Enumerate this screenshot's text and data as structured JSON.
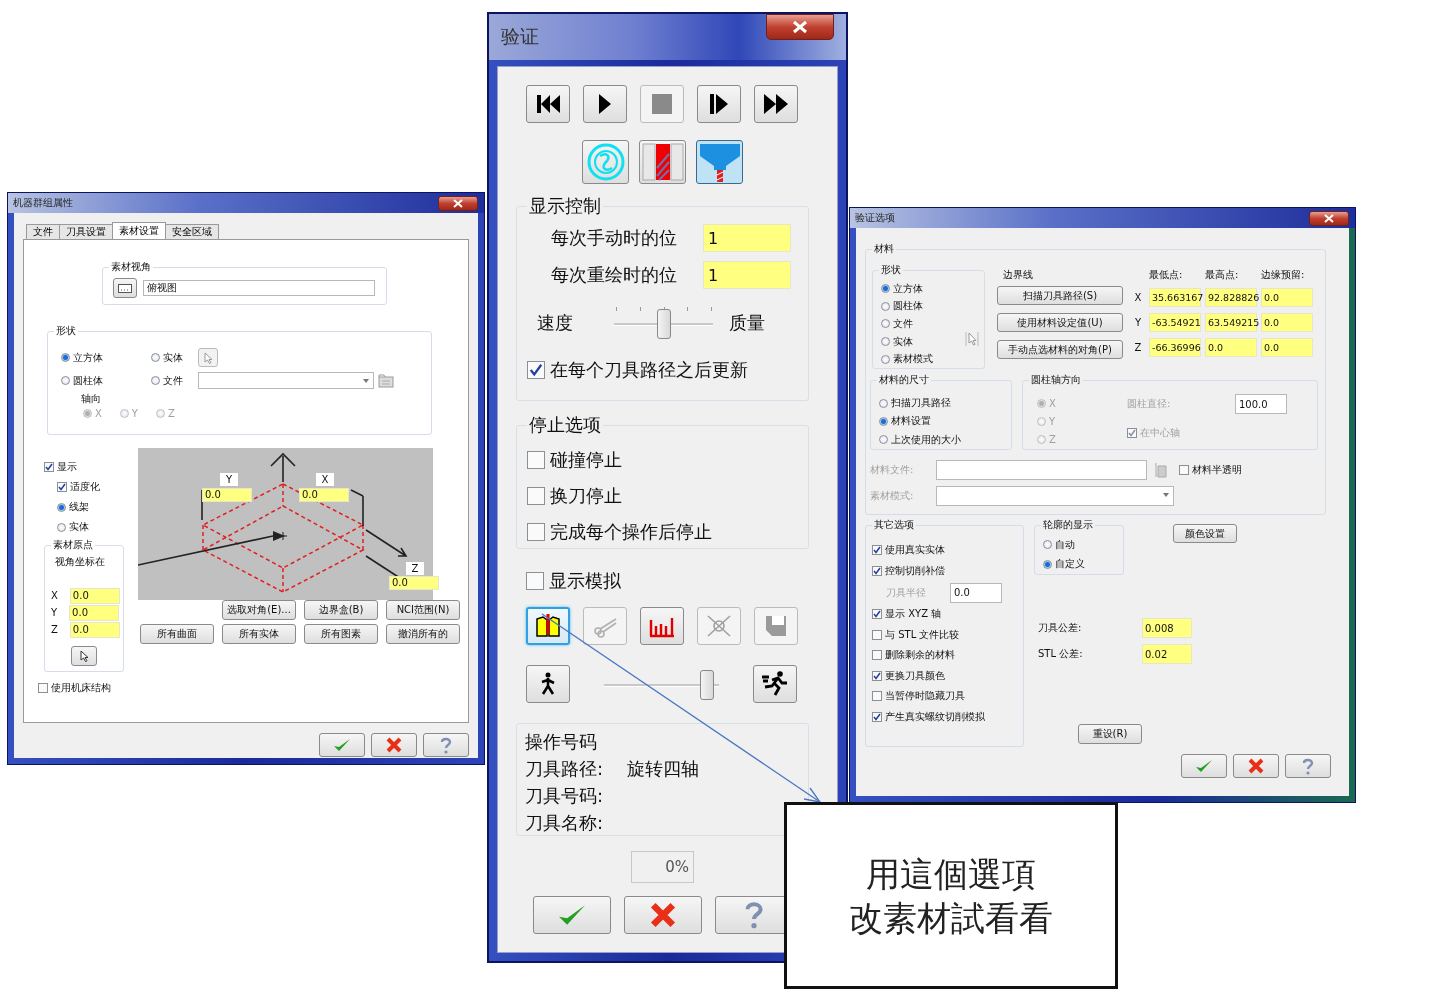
{
  "left_window": {
    "title": "机器群组属性",
    "tabs": [
      {
        "label": "文件",
        "selected": false
      },
      {
        "label": "刀具设置",
        "selected": false
      },
      {
        "label": "素材设置",
        "selected": true
      },
      {
        "label": "安全区域",
        "selected": false
      }
    ],
    "stock_view": {
      "title": "素材视角",
      "value": "俯视图"
    },
    "shape": {
      "title": "形状",
      "options": [
        {
          "label": "立方体",
          "selected": true
        },
        {
          "label": "实体",
          "selected": false
        },
        {
          "label": "圆柱体",
          "selected": false
        },
        {
          "label": "文件",
          "selected": false
        }
      ],
      "axis_title": "轴向",
      "axes_disabled": true,
      "axes": [
        {
          "label": "X",
          "selected": true
        },
        {
          "label": "Y",
          "selected": false
        },
        {
          "label": "Z",
          "selected": false
        }
      ]
    },
    "display": {
      "label": "显示",
      "checked": true
    },
    "display_options": [
      {
        "kind": "checkbox",
        "label": "适度化",
        "checked": true
      },
      {
        "kind": "radio",
        "label": "线架",
        "selected": true
      },
      {
        "kind": "radio",
        "label": "实体",
        "selected": false
      }
    ],
    "origin": {
      "title": "素材原点",
      "subtitle": "视角坐标在",
      "coords": [
        {
          "axis": "X",
          "value": "0.0"
        },
        {
          "axis": "Y",
          "value": "0.0"
        },
        {
          "axis": "Z",
          "value": "0.0"
        }
      ]
    },
    "preview_labels": [
      {
        "axis": "Y",
        "value": "0.0"
      },
      {
        "axis": "X",
        "value": "0.0"
      },
      {
        "axis": "Z",
        "value": "0.0"
      }
    ],
    "button_rows": [
      [
        "选取对角(E)...",
        "边界盒(B)",
        "NCI范围(N)"
      ],
      [
        "所有曲面",
        "所有实体",
        "所有图素",
        "撤消所有的"
      ]
    ],
    "machine_structure": {
      "label": "使用机床结构",
      "checked": false
    }
  },
  "middle_window": {
    "title": "验证",
    "player_buttons": [
      {
        "kind": "rewind",
        "disabled": false
      },
      {
        "kind": "play",
        "disabled": false
      },
      {
        "kind": "stop",
        "disabled": true
      },
      {
        "kind": "step",
        "disabled": false
      },
      {
        "kind": "forward",
        "disabled": false
      }
    ],
    "mode_buttons": [
      {
        "kind": "swirl"
      },
      {
        "kind": "stock_bar"
      },
      {
        "kind": "tool"
      }
    ],
    "display_control": {
      "title": "显示控制",
      "fields": [
        {
          "label": "每次手动时的位",
          "value": "1"
        },
        {
          "label": "每次重绘时的位",
          "value": "1"
        }
      ],
      "slider": {
        "left": "速度",
        "right": "质量",
        "level": 0.5
      },
      "update": {
        "label": "在每个刀具路径之后更新",
        "checked": true
      }
    },
    "stop_options": {
      "title": "停止选项",
      "items": [
        {
          "label": "碰撞停止",
          "checked": false
        },
        {
          "label": "换刀停止",
          "checked": false
        },
        {
          "label": "完成每个操作后停止",
          "checked": false
        }
      ]
    },
    "simulate": {
      "label": "显示模拟",
      "checked": false
    },
    "tool_buttons": [
      {
        "kind": "stock",
        "selected": true,
        "disabled": false
      },
      {
        "kind": "scissors",
        "selected": false,
        "disabled": true
      },
      {
        "kind": "bars",
        "selected": false,
        "disabled": false
      },
      {
        "kind": "cross",
        "selected": false,
        "disabled": true
      },
      {
        "kind": "disk",
        "selected": false,
        "disabled": true
      }
    ],
    "speed_slider": {
      "level": 0.95
    },
    "info": {
      "title": "操作号码",
      "rows": [
        {
          "label": "刀具路径:",
          "value": "旋转四轴"
        },
        {
          "label": "刀具号码:"
        },
        {
          "label": "刀具名称:"
        }
      ]
    },
    "progress": {
      "text": "0%"
    }
  },
  "right_window": {
    "title": "验证选项",
    "material": {
      "title": "材料",
      "shape_title": "形状",
      "shapes": [
        {
          "label": "立方体",
          "selected": true
        },
        {
          "label": "圆柱体",
          "selected": false
        },
        {
          "label": "文件",
          "selected": false
        },
        {
          "label": "实体",
          "selected": false
        },
        {
          "label": "素材模式",
          "selected": false
        }
      ],
      "boundary_title": "边界线",
      "boundary_buttons": [
        "扫描刀具路径(S)",
        "使用材料设定值(U)",
        "手动点选材料的对角(P)"
      ],
      "columns": [
        "最低点:",
        "最高点:",
        "边缘预留:"
      ],
      "rows": [
        {
          "axis": "X",
          "values": [
            "35.663167",
            "92.828826",
            "0.0"
          ]
        },
        {
          "axis": "Y",
          "values": [
            "-63.54921",
            "63.549215",
            "0.0"
          ]
        },
        {
          "axis": "Z",
          "values": [
            "-66.36996",
            "0.0",
            "0.0"
          ]
        }
      ],
      "size_title": "材料的尺寸",
      "sizes": [
        {
          "label": "扫描刀具路径",
          "selected": false
        },
        {
          "label": "材料设置",
          "selected": true
        },
        {
          "label": "上次使用的大小",
          "selected": false
        }
      ],
      "cylinder_title": "圆柱轴方向",
      "cylinder_disabled": true,
      "cylinder_axes": [
        {
          "label": "X",
          "selected": true
        },
        {
          "label": "Y",
          "selected": false
        },
        {
          "label": "Z",
          "selected": false
        }
      ],
      "diameter_label": "圆柱直径:",
      "diameter": "100.0",
      "center": {
        "label": "在中心轴",
        "checked": true
      },
      "file_disabled": true,
      "file_label": "材料文件:",
      "translucent": {
        "label": "材料半透明",
        "checked": false
      },
      "mode_label": "素材模式:"
    },
    "other": {
      "title": "其它选项",
      "items": [
        {
          "kind": "check",
          "label": "使用真实实体",
          "checked": true
        },
        {
          "kind": "check",
          "label": "控制切削补偿",
          "checked": true
        },
        {
          "kind": "field",
          "label": "刀具半径",
          "value": "0.0"
        },
        {
          "kind": "check",
          "label": "显示 XYZ 轴",
          "checked": true
        },
        {
          "kind": "check",
          "label": "与 STL 文件比较",
          "checked": false
        },
        {
          "kind": "check",
          "label": "删除剩余的材料",
          "checked": false
        },
        {
          "kind": "check",
          "label": "更换刀具颜色",
          "checked": true
        },
        {
          "kind": "check",
          "label": "当暂停时隐藏刀具",
          "checked": false
        },
        {
          "kind": "check",
          "label": "产生真实螺纹切削模拟",
          "checked": true
        }
      ]
    },
    "outline": {
      "title": "轮廓的显示",
      "options": [
        {
          "label": "自动",
          "selected": false
        },
        {
          "label": "自定义",
          "selected": true
        }
      ]
    },
    "color_button": "颜色设置",
    "tolerances": [
      {
        "label": "刀具公差:",
        "value": "0.008"
      },
      {
        "label": "STL 公差:",
        "value": "0.02"
      }
    ],
    "reset_button": "重设(R)"
  },
  "callout": {
    "lines": [
      "用這個選項",
      "改素材試看看"
    ]
  }
}
